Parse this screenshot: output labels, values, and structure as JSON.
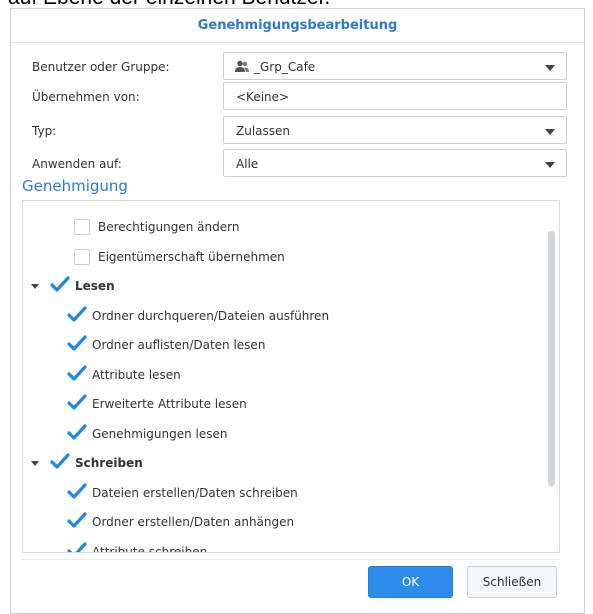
{
  "background_text": "auf Ebene der einzelnen Benutzer.",
  "dialog": {
    "title": "Genehmigungsbearbeitung",
    "fields": {
      "user": {
        "label": "Benutzer oder Gruppe:",
        "value": "_Grp_Cafe",
        "icon": "user-group-icon"
      },
      "inherit": {
        "label": "Übernehmen von:",
        "value": "<Keine>"
      },
      "type": {
        "label": "Typ:",
        "value": "Zulassen"
      },
      "apply": {
        "label": "Anwenden auf:",
        "value": "Alle"
      }
    },
    "section_title": "Genehmigung",
    "permissions": [
      {
        "label": "Berechtigungen ändern",
        "checked": false,
        "group": false
      },
      {
        "label": "Eigentümerschaft übernehmen",
        "checked": false,
        "group": false
      },
      {
        "label": "Lesen",
        "checked": true,
        "group": true
      },
      {
        "label": "Ordner durchqueren/Dateien ausführen",
        "checked": true,
        "group": false
      },
      {
        "label": "Ordner auflisten/Daten lesen",
        "checked": true,
        "group": false
      },
      {
        "label": "Attribute lesen",
        "checked": true,
        "group": false
      },
      {
        "label": "Erweiterte Attribute lesen",
        "checked": true,
        "group": false
      },
      {
        "label": "Genehmigungen lesen",
        "checked": true,
        "group": false
      },
      {
        "label": "Schreiben",
        "checked": true,
        "group": true
      },
      {
        "label": "Dateien erstellen/Daten schreiben",
        "checked": true,
        "group": false
      },
      {
        "label": "Ordner erstellen/Daten anhängen",
        "checked": true,
        "group": false
      },
      {
        "label": "Attribute schreiben",
        "checked": true,
        "group": false
      }
    ],
    "buttons": {
      "ok": "OK",
      "close": "Schließen"
    },
    "colors": {
      "accent": "#2b7ad1",
      "check": "#1e87e5",
      "ok_button": "#2d8ceb"
    }
  }
}
